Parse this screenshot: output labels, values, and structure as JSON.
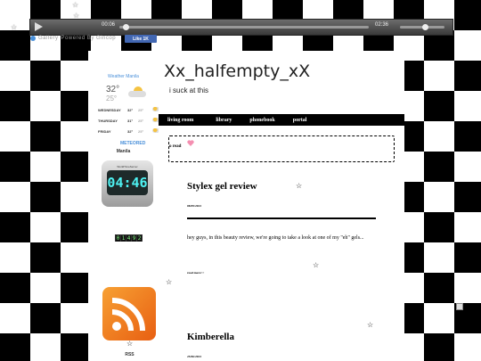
{
  "player": {
    "current_time": "00:06",
    "duration": "02:36",
    "progress": 0.02,
    "volume": 0.55
  },
  "gallery": {
    "label": "Gallery",
    "powered": "Powered By Gincop"
  },
  "facebook": {
    "like_label": "Like 1K"
  },
  "weather": {
    "title": "Weather Manila",
    "temp": "32°",
    "low": "25°",
    "forecast": [
      {
        "day": "WEDNESDAY",
        "high": "32°",
        "low": "25°"
      },
      {
        "day": "THURSDAY",
        "high": "31°",
        "low": "25°"
      },
      {
        "day": "FRIDAY",
        "high": "32°",
        "low": "25°"
      }
    ],
    "provider": "METEORED"
  },
  "clock": {
    "brand": "WorldTimeServer",
    "time": "04:46",
    "city": "Manila"
  },
  "counter": {
    "digits": [
      "0",
      "1",
      "4",
      "9",
      "2"
    ]
  },
  "rss": {
    "label": "RSS"
  },
  "header": {
    "title": "Xx_halfempty_xX",
    "tagline": "i suck at this"
  },
  "nav": {
    "items": [
      "living room",
      "library",
      "phonebook",
      "portal"
    ]
  },
  "notice": {
    "text": "o read"
  },
  "posts": [
    {
      "title": "Stylex gel review",
      "date": "08/09/2023",
      "body": "hey guys, in this beauty review, we're going to take a look at one of my \"eh\" gels...",
      "read_more": "read more>>"
    },
    {
      "title": "Kimberella",
      "date": "25/06/2023"
    }
  ],
  "colors": {
    "accent": "#4a90d9",
    "nav_bg": "#000000",
    "clock_digits": "#4ef2f2",
    "rss_orange": "#f08a24",
    "heart": "#f48fb1"
  }
}
